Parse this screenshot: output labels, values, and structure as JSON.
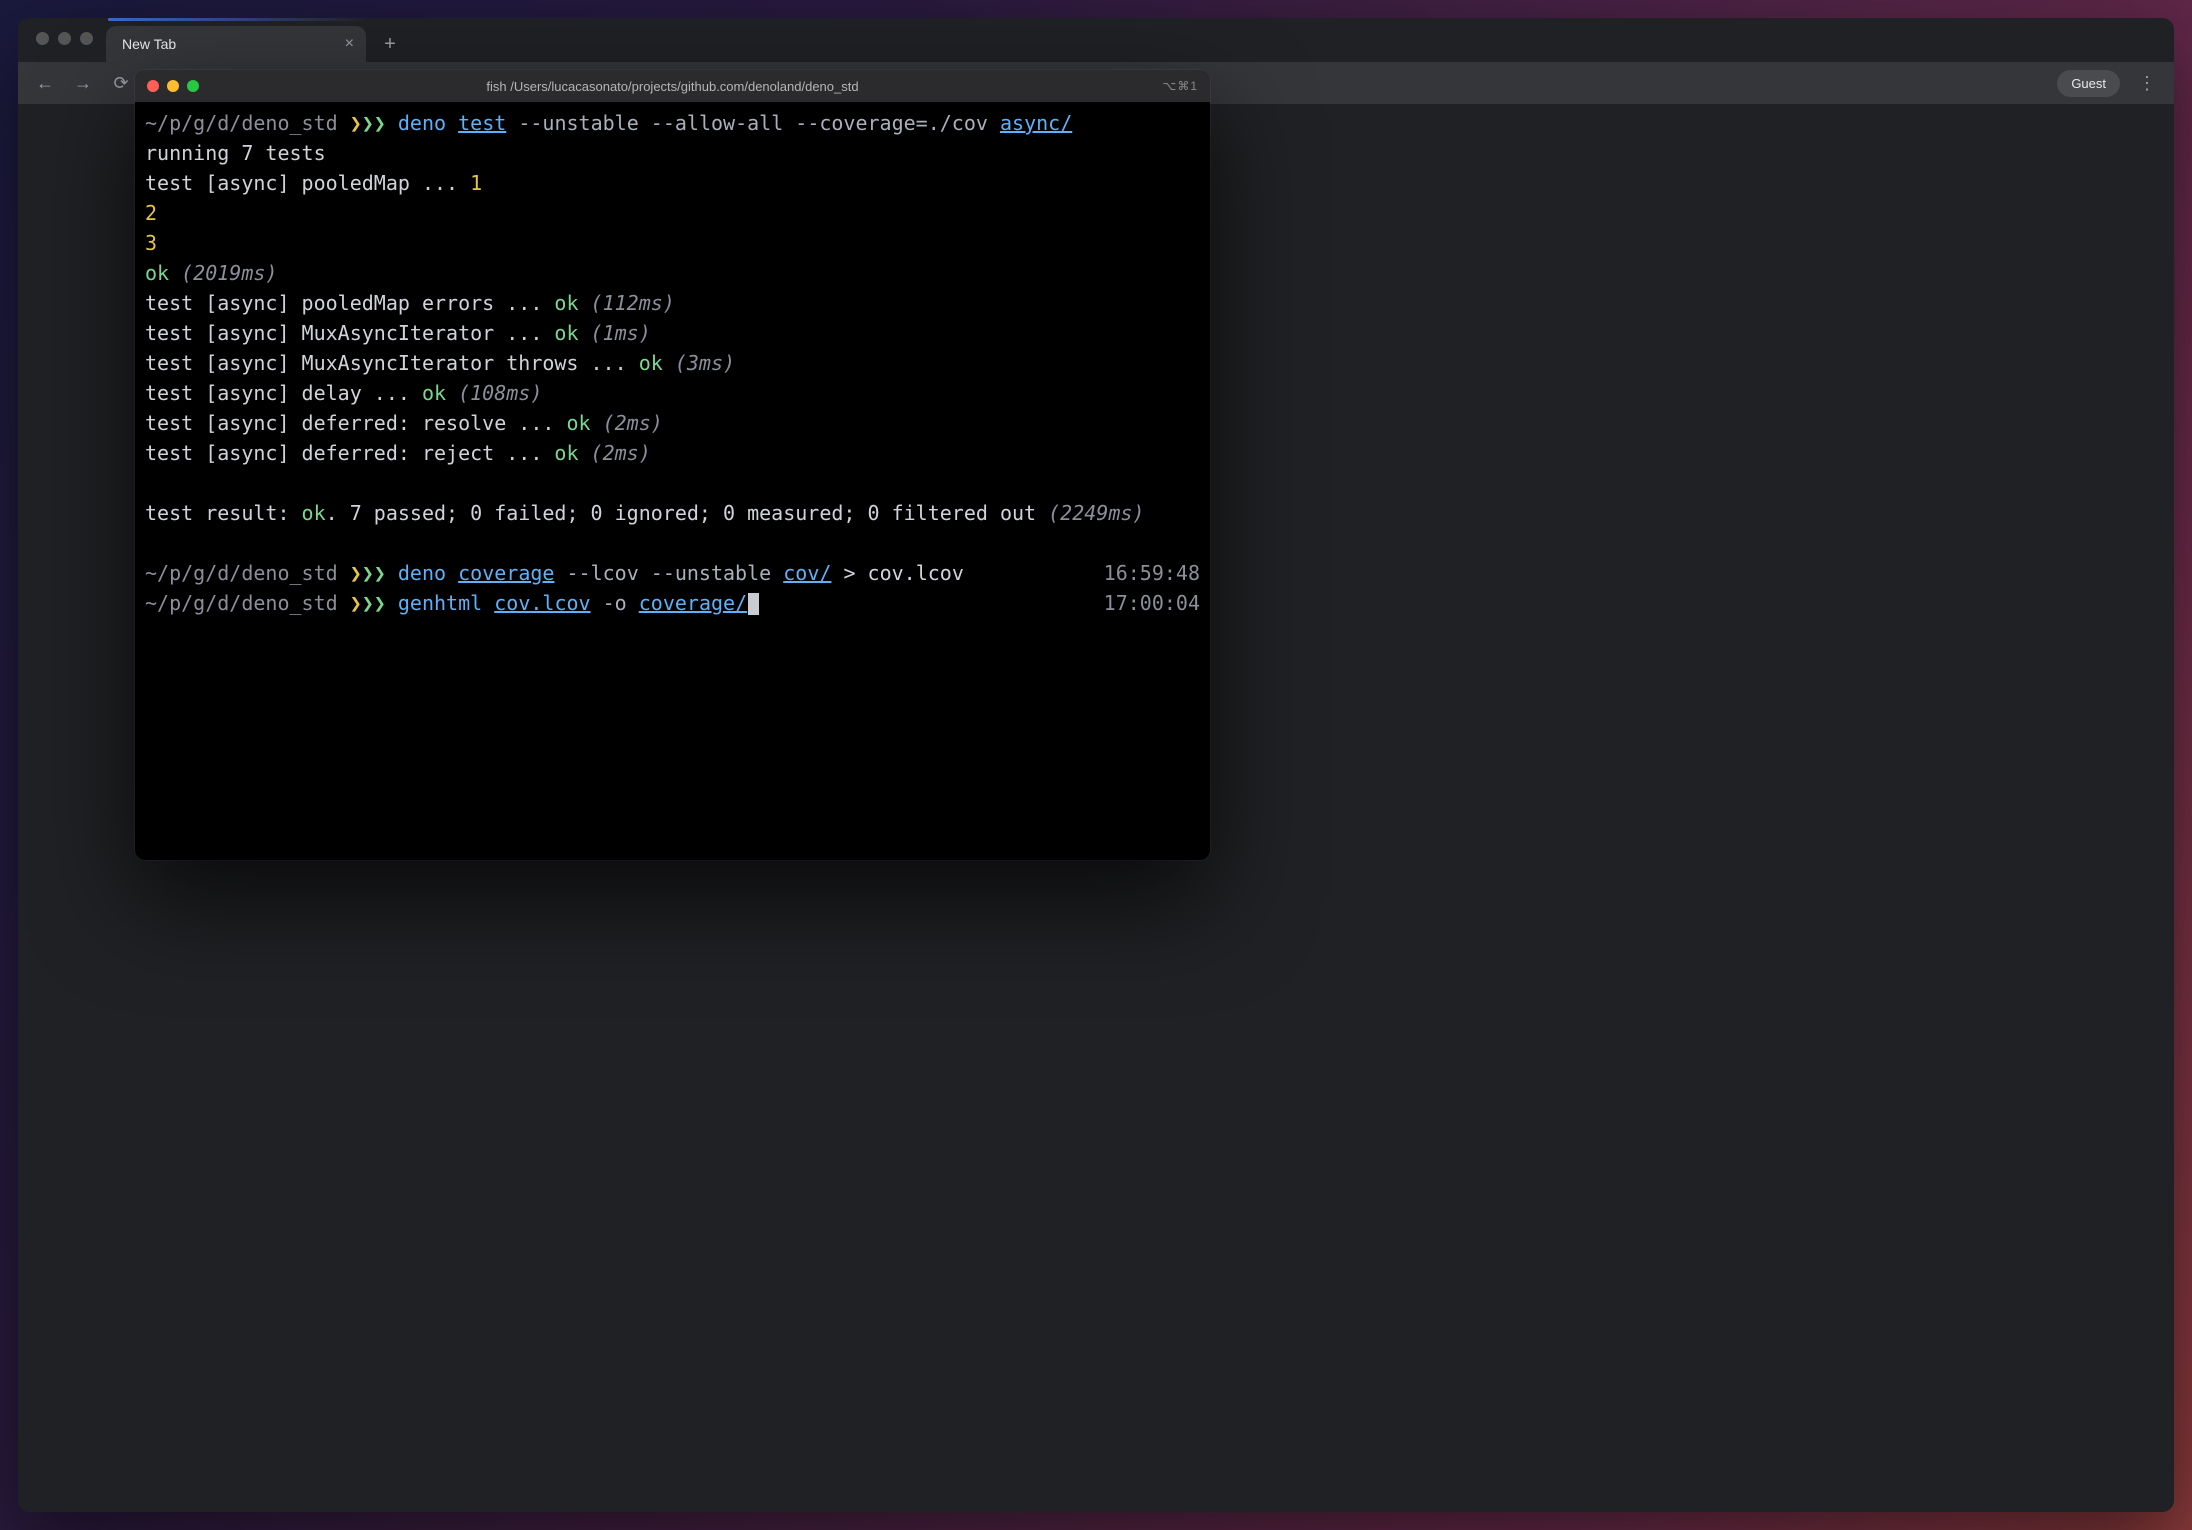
{
  "browser": {
    "tab_title": "New Tab",
    "guest_label": "Guest"
  },
  "terminal": {
    "title": "fish /Users/lucacasonato/projects/github.com/denoland/deno_std",
    "shortcut": "⌥⌘1",
    "prompt_path": "~/p/g/d/deno_std",
    "commands": [
      {
        "cmd": "deno",
        "arg": "test",
        "flags": "--unstable --allow-all --coverage=./cov",
        "trailing_arg": "async/",
        "time": ""
      },
      {
        "cmd": "deno",
        "arg": "coverage",
        "flags": "--lcov --unstable",
        "trailing_arg": "cov/",
        "extra": " > cov.lcov",
        "time": "16:59:48"
      },
      {
        "cmd": "genhtml",
        "arg": "cov.lcov",
        "flags": "-o",
        "trailing_arg": "coverage/",
        "time": "17:00:04",
        "cursor": true
      }
    ],
    "output": {
      "running": "running 7 tests",
      "lines": [
        {
          "text": "test [async] pooledMap ... ",
          "tail_yellow": "1"
        },
        {
          "yellow": "2"
        },
        {
          "yellow": "3"
        },
        {
          "ok": "ok",
          "dim": "(2019ms)"
        },
        {
          "text": "test [async] pooledMap errors ... ",
          "ok": "ok",
          "dim": "(112ms)"
        },
        {
          "text": "test [async] MuxAsyncIterator ... ",
          "ok": "ok",
          "dim": "(1ms)"
        },
        {
          "text": "test [async] MuxAsyncIterator throws ... ",
          "ok": "ok",
          "dim": "(3ms)"
        },
        {
          "text": "test [async] delay ... ",
          "ok": "ok",
          "dim": "(108ms)"
        },
        {
          "text": "test [async] deferred: resolve ... ",
          "ok": "ok",
          "dim": "(2ms)"
        },
        {
          "text": "test [async] deferred: reject ... ",
          "ok": "ok",
          "dim": "(2ms)"
        }
      ],
      "summary_pre": "test result: ",
      "summary_ok": "ok",
      "summary_post": ". 7 passed; 0 failed; 0 ignored; 0 measured; 0 filtered out ",
      "summary_dim": "(2249ms)"
    }
  }
}
